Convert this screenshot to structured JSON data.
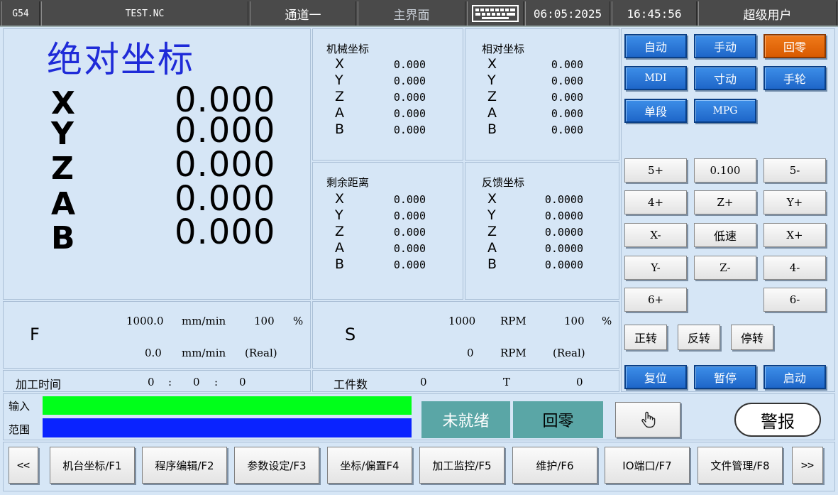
{
  "topbar": {
    "coord_system": "G54",
    "program": "TEST.NC",
    "channel": "通道一",
    "screen": "主界面",
    "date": "06:05:2025",
    "time": "16:45:56",
    "user": "超级用户",
    "keyboard_icon": "keyboard-icon"
  },
  "absolute": {
    "title": "绝对坐标",
    "axes": [
      {
        "name": "X",
        "value": "0.000"
      },
      {
        "name": "Y",
        "value": "0.000"
      },
      {
        "name": "Z",
        "value": "0.000"
      },
      {
        "name": "A",
        "value": "0.000"
      },
      {
        "name": "B",
        "value": "0.000"
      }
    ]
  },
  "machine": {
    "title": "机械坐标",
    "axes": [
      {
        "name": "X",
        "value": "0.000"
      },
      {
        "name": "Y",
        "value": "0.000"
      },
      {
        "name": "Z",
        "value": "0.000"
      },
      {
        "name": "A",
        "value": "0.000"
      },
      {
        "name": "B",
        "value": "0.000"
      }
    ]
  },
  "relative": {
    "title": "相对坐标",
    "axes": [
      {
        "name": "X",
        "value": "0.000"
      },
      {
        "name": "Y",
        "value": "0.000"
      },
      {
        "name": "Z",
        "value": "0.000"
      },
      {
        "name": "A",
        "value": "0.000"
      },
      {
        "name": "B",
        "value": "0.000"
      }
    ]
  },
  "remaining": {
    "title": "剩余距离",
    "axes": [
      {
        "name": "X",
        "value": "0.000"
      },
      {
        "name": "Y",
        "value": "0.000"
      },
      {
        "name": "Z",
        "value": "0.000"
      },
      {
        "name": "A",
        "value": "0.000"
      },
      {
        "name": "B",
        "value": "0.000"
      }
    ]
  },
  "feedback": {
    "title": "反馈坐标",
    "axes": [
      {
        "name": "X",
        "value": "0.0000"
      },
      {
        "name": "Y",
        "value": "0.0000"
      },
      {
        "name": "Z",
        "value": "0.0000"
      },
      {
        "name": "A",
        "value": "0.0000"
      },
      {
        "name": "B",
        "value": "0.0000"
      }
    ]
  },
  "feed": {
    "label": "F",
    "set_value": "1000.0",
    "set_unit": "mm/min",
    "override": "100",
    "override_unit": "%",
    "real_value": "0.0",
    "real_unit": "mm/min",
    "real_label": "(Real)"
  },
  "spindle": {
    "label": "S",
    "set_value": "1000",
    "set_unit": "RPM",
    "override": "100",
    "override_unit": "%",
    "real_value": "0",
    "real_unit": "RPM",
    "real_label": "(Real)"
  },
  "status_row": {
    "time_label": "加工时间",
    "hours": "0",
    "sep1": ":",
    "minutes": "0",
    "sep2": ":",
    "seconds": "0",
    "count_label": "工件数",
    "count": "0",
    "tool_label": "T",
    "tool": "0"
  },
  "modes": {
    "auto": "自动",
    "manual": "手动",
    "home": "回零",
    "mdi": "MDI",
    "jog": "寸动",
    "handwheel": "手轮",
    "single": "单段",
    "mpg": "MPG"
  },
  "jog": {
    "a5p": "5+",
    "step": "0.100",
    "a5m": "5-",
    "a4p": "4+",
    "zp": "Z+",
    "yp": "Y+",
    "xm": "X-",
    "speed": "低速",
    "xp": "X+",
    "ym": "Y-",
    "zm": "Z-",
    "a4m": "4-",
    "a6p": "6+",
    "a6m": "6-"
  },
  "spindle_ctrl": {
    "cw": "正转",
    "ccw": "反转",
    "stop": "停转"
  },
  "cycle": {
    "reset": "复位",
    "pause": "暂停",
    "start": "启动"
  },
  "input": {
    "input_label": "输入",
    "range_label": "范围",
    "input_color": "#00ff1a",
    "range_color": "#0a23ff"
  },
  "machine_status": {
    "ready": "未就绪",
    "mode": "回零",
    "status_color": "#5aa6a6"
  },
  "alarm": {
    "label": "警报",
    "hand_icon": "hand-pointer-icon"
  },
  "softkeys": {
    "prev": "<<",
    "f1": "机台坐标/F1",
    "f2": "程序编辑/F2",
    "f3": "参数设定/F3",
    "f4": "坐标/偏置F4",
    "f5": "加工监控/F5",
    "f6": "维护/F6",
    "f7": "IO端口/F7",
    "f8": "文件管理/F8",
    "next": ">>"
  }
}
